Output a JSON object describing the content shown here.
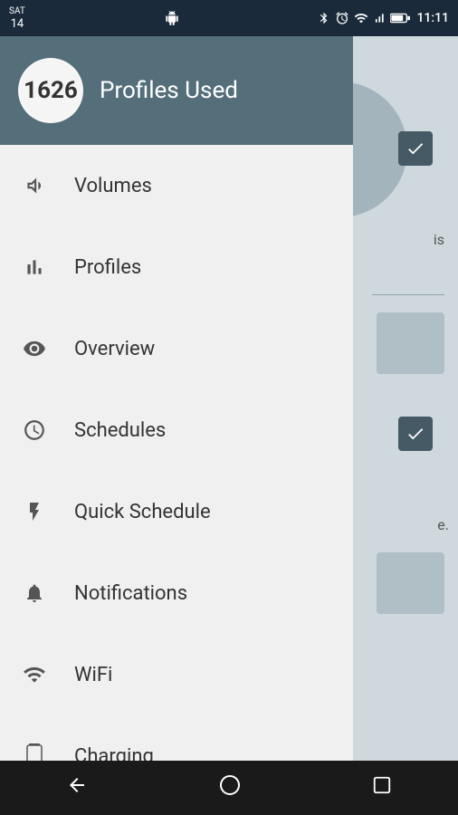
{
  "statusBar": {
    "day": "SAT",
    "date": "14",
    "time": "11:11",
    "bluetooth": "BT",
    "alarm": "⏰",
    "wifi": "▼",
    "signal": "📶",
    "battery": "🔋"
  },
  "header": {
    "profileCount": "1626",
    "title": "Profiles Used"
  },
  "menuItems": [
    {
      "id": "volumes",
      "label": "Volumes",
      "icon": "volume"
    },
    {
      "id": "profiles",
      "label": "Profiles",
      "icon": "profiles"
    },
    {
      "id": "overview",
      "label": "Overview",
      "icon": "overview"
    },
    {
      "id": "schedules",
      "label": "Schedules",
      "icon": "schedules"
    },
    {
      "id": "quick-schedule",
      "label": "Quick Schedule",
      "icon": "quickschedule"
    },
    {
      "id": "notifications",
      "label": "Notifications",
      "icon": "notifications"
    },
    {
      "id": "wifi",
      "label": "WiFi",
      "icon": "wifi"
    },
    {
      "id": "charging",
      "label": "Charging",
      "icon": "charging"
    }
  ],
  "bottomNav": {
    "back": "◁",
    "home": "○",
    "recent": "□"
  }
}
